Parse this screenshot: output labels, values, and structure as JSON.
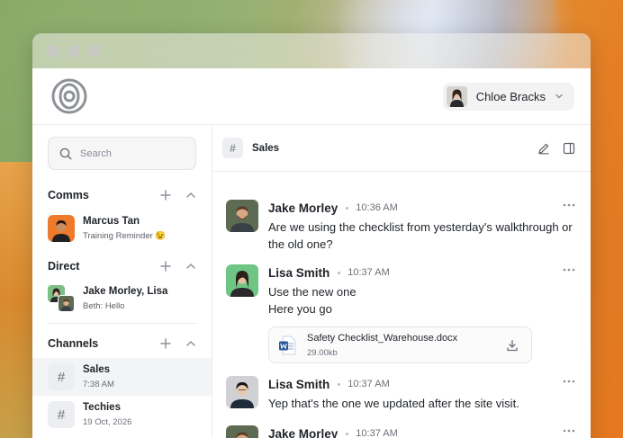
{
  "user": {
    "name": "Chloe Bracks"
  },
  "search": {
    "placeholder": "Search"
  },
  "sidebar": {
    "comms": {
      "title": "Comms",
      "items": [
        {
          "name": "Marcus Tan",
          "preview": "Training Reminder 😉"
        }
      ]
    },
    "direct": {
      "title": "Direct",
      "items": [
        {
          "name": "Jake Morley, Lisa",
          "preview": "Beth: Hello"
        }
      ]
    },
    "channels": {
      "title": "Channels",
      "items": [
        {
          "name": "Sales",
          "time": "7:38 AM",
          "active": true
        },
        {
          "name": "Techies",
          "time": "19 Oct, 2026",
          "active": false
        }
      ]
    }
  },
  "channel": {
    "name": "Sales"
  },
  "messages": [
    {
      "author": "Jake Morley",
      "time": "10:36 AM",
      "lines": [
        "Are we using the checklist from yesterday's walkthrough or",
        "the old one?"
      ]
    },
    {
      "author": "Lisa Smith",
      "time": "10:37 AM",
      "lines": [
        "Use the new one",
        "Here you go"
      ],
      "attachment": {
        "name": "Safety Checklist_Warehouse.docx",
        "size": "29.00kb"
      }
    },
    {
      "author": "Lisa Smith",
      "time": "10:37 AM",
      "lines": [
        "Yep that's the one we updated after the site visit."
      ]
    },
    {
      "author": "Jake Morley",
      "time": "10:37 AM",
      "lines": []
    }
  ],
  "icons": {
    "logo": "spiral-logo-icon",
    "search": "search-icon",
    "add": "plus-icon",
    "collapse": "chevron-up-icon",
    "edit": "edit-icon",
    "panel": "sidebar-panel-icon",
    "more": "more-horizontal-icon",
    "download": "download-icon",
    "word": "word-document-icon"
  },
  "colors": {
    "accent_word": "#2b579a",
    "muted": "#6b7078"
  }
}
